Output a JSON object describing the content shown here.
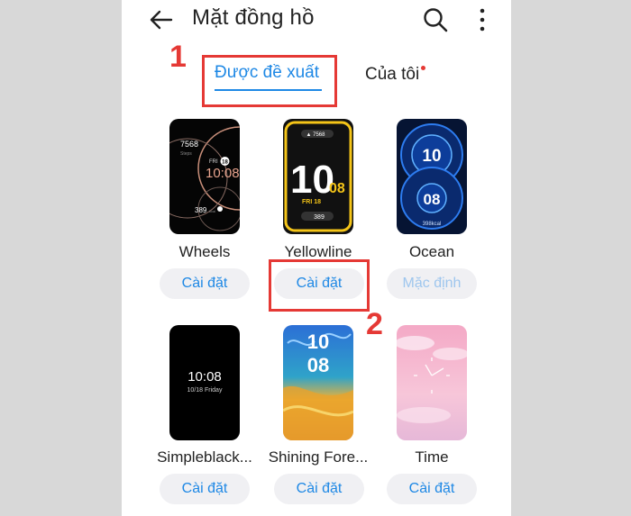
{
  "header": {
    "title": "Mặt đồng hồ",
    "back_icon": "arrow-left-icon",
    "search_icon": "search-icon",
    "more_icon": "more-vertical-icon"
  },
  "tabs": [
    {
      "label": "Được đề xuất",
      "selected": true
    },
    {
      "label": "Của tôi",
      "has_badge": true
    }
  ],
  "faces": [
    {
      "name": "Wheels",
      "button": "Cài đặt",
      "preview": {
        "steps": "7568",
        "steps_label": "Steps",
        "day": "FRI",
        "date": "18",
        "time": "10:08",
        "kcal": "389",
        "kcal_unit": "kcal"
      }
    },
    {
      "name": "Yellowline",
      "button": "Cài đặt",
      "preview": {
        "hour": "10",
        "minute": "08",
        "day_date": "FRI 18",
        "bottom": "389"
      }
    },
    {
      "name": "Ocean",
      "button": "Mặc định",
      "preview": {
        "hour": "10",
        "minute": "08",
        "kcal": "398kcal"
      }
    },
    {
      "name": "Simpleblack...",
      "button": "Cài đặt",
      "preview": {
        "time": "10:08",
        "date": "10/18 Friday"
      }
    },
    {
      "name": "Shining Fore...",
      "button": "Cài đặt",
      "preview": {
        "hour": "10",
        "minute": "08"
      }
    },
    {
      "name": "Time",
      "button": "Cài đặt",
      "preview": {}
    }
  ],
  "annotations": {
    "step1": "1",
    "step2": "2"
  },
  "colors": {
    "accent": "#1e88e5",
    "highlight": "#e53935",
    "yellow": "#f5c518"
  }
}
